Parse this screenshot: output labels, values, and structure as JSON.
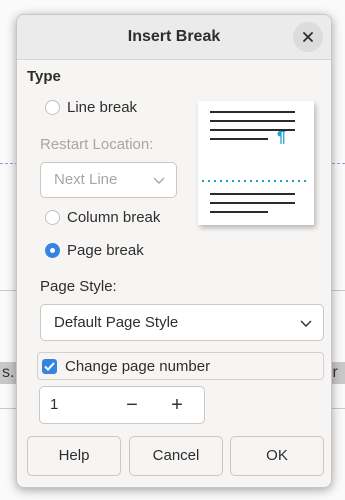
{
  "background": {
    "left_fragment": "s...",
    "right_fragment": "ir"
  },
  "dialog": {
    "title": "Insert Break",
    "close_icon": "close-icon",
    "type_section": "Type",
    "options": {
      "line_break": "Line break",
      "restart_location_label": "Restart Location:",
      "restart_location_value": "Next Line",
      "column_break": "Column break",
      "page_break": "Page break"
    },
    "selected_option": "page_break",
    "preview_marker": "¶",
    "page_style_label": "Page Style:",
    "page_style_value": "Default Page Style",
    "change_page_number": {
      "label": "Change page number",
      "checked": true
    },
    "page_number": "1",
    "spin_minus": "−",
    "spin_plus": "+",
    "buttons": {
      "help": "Help",
      "cancel": "Cancel",
      "ok": "OK"
    },
    "accent_color": "#3584e4"
  }
}
